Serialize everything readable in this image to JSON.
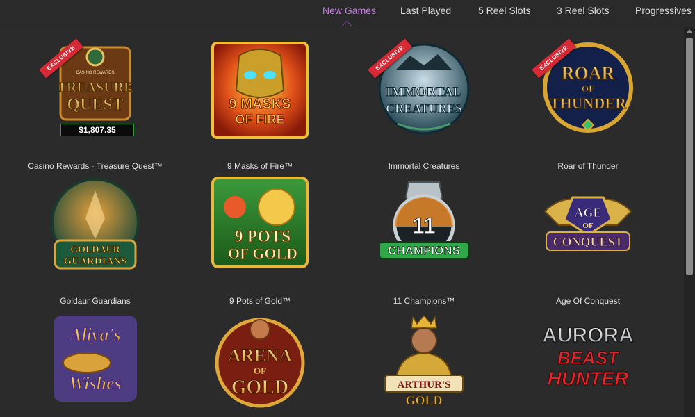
{
  "nav": {
    "tabs": [
      {
        "label": "New Games",
        "active": true
      },
      {
        "label": "Last Played",
        "active": false
      },
      {
        "label": "5 Reel Slots",
        "active": false
      },
      {
        "label": "3 Reel Slots",
        "active": false
      },
      {
        "label": "Progressives",
        "active": false
      }
    ],
    "active_color": "#c77ee6",
    "underline_color": "#a15cc4"
  },
  "games": [
    {
      "title": "Casino Rewards - Treasure Quest™",
      "logo_lines": [
        "CASINO REWARDS",
        "TREASURE",
        "QUEST"
      ],
      "badge": "EXCLUSIVE",
      "jackpot": "$1,807.35"
    },
    {
      "title": "9 Masks of Fire™",
      "logo_lines": [
        "9 MASKS",
        "OF FIRE"
      ],
      "badge": "",
      "jackpot": ""
    },
    {
      "title": "Immortal Creatures",
      "logo_lines": [
        "IMMORTAL",
        "CREATURES"
      ],
      "badge": "EXCLUSIVE",
      "jackpot": ""
    },
    {
      "title": "Roar of Thunder",
      "logo_lines": [
        "ROAR",
        "OF",
        "THUNDER"
      ],
      "badge": "EXCLUSIVE",
      "jackpot": ""
    },
    {
      "title": "Goldaur Guardians",
      "logo_lines": [
        "GOLDAUR",
        "GUARDIANS"
      ],
      "badge": "",
      "jackpot": ""
    },
    {
      "title": "9 Pots of Gold™",
      "logo_lines": [
        "9 POTS",
        "OF GOLD"
      ],
      "badge": "",
      "jackpot": ""
    },
    {
      "title": "11 Champions™",
      "logo_lines": [
        "11",
        "CHAMPIONS"
      ],
      "badge": "",
      "jackpot": ""
    },
    {
      "title": "Age Of Conquest",
      "logo_lines": [
        "AGE",
        "OF",
        "CONQUEST"
      ],
      "badge": "",
      "jackpot": ""
    },
    {
      "title": "",
      "logo_lines": [
        "Aliya's",
        "Wishes"
      ],
      "badge": "",
      "jackpot": ""
    },
    {
      "title": "",
      "logo_lines": [
        "ARENA",
        "OF",
        "GOLD"
      ],
      "badge": "",
      "jackpot": ""
    },
    {
      "title": "",
      "logo_lines": [
        "ARTHUR'S",
        "GOLD"
      ],
      "badge": "",
      "jackpot": ""
    },
    {
      "title": "",
      "logo_lines": [
        "AURORA",
        "BEAST",
        "HUNTER"
      ],
      "badge": "",
      "jackpot": ""
    }
  ]
}
